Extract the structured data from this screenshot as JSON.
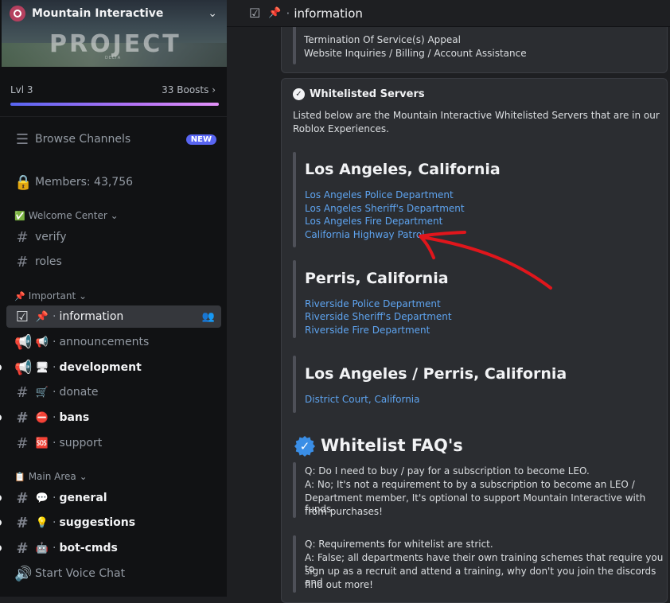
{
  "server": {
    "name": "Mountain Interactive",
    "banner_title": "PROJECT",
    "banner_sub": "DELTA"
  },
  "boost": {
    "level": "Lvl 3",
    "boosts": "33 Boosts"
  },
  "sidebar": {
    "browse": {
      "label": "Browse Channels",
      "badge": "NEW"
    },
    "members": "Members: 43,756",
    "categories": {
      "welcome": "Welcome Center",
      "important": "Important",
      "main": "Main Area"
    },
    "channels": {
      "verify": "verify",
      "roles": "roles",
      "information": "information",
      "announcements": "announcements",
      "development": "development",
      "donate": "donate",
      "bans": "bans",
      "support": "support",
      "general": "general",
      "suggestions": "suggestions",
      "bot_cmds": "bot-cmds",
      "voice": "Start Voice Chat"
    }
  },
  "topbar": {
    "channel": "information"
  },
  "thread1": {
    "lines": [
      "Termination Of Service(s) Appeal",
      "Website Inquiries / Billing / Account Assistance"
    ]
  },
  "whitelist": {
    "heading": "Whitelisted Servers",
    "intro1": "Listed below are the Mountain Interactive Whitelisted Servers that are in our",
    "intro2": "Roblox Experiences.",
    "groups": [
      {
        "title": "Los Angeles, California",
        "links": [
          "Los Angeles Police Department",
          "Los Angeles Sheriff's Department",
          "Los Angeles Fire Department",
          "California Highway Patrol"
        ]
      },
      {
        "title": "Perris, California",
        "links": [
          "Riverside Police Department",
          "Riverside Sheriff's Department",
          "Riverside Fire Department"
        ]
      },
      {
        "title": "Los Angeles / Perris, California",
        "links": [
          "District Court, California"
        ]
      }
    ]
  },
  "faq": {
    "title": "Whitelist FAQ's",
    "q1": [
      "Q: Do I need to buy / pay for a subscription to become LEO.",
      "A: No; It's not a requirement to by a subscription to become an LEO /",
      "Department member, It's optional to support Mountain Interactive with funds",
      "from purchases!"
    ],
    "q2": [
      "Q: Requirements for whitelist are strict.",
      "A: False; all departments have their own training schemes that require you to",
      "sign up as a recruit and attend a training, why don't you join the discords and",
      "find out more!"
    ]
  },
  "colors": {
    "link": "#5ea4f0",
    "annotation": "#e0161c",
    "boost_start": "#5865f2"
  }
}
